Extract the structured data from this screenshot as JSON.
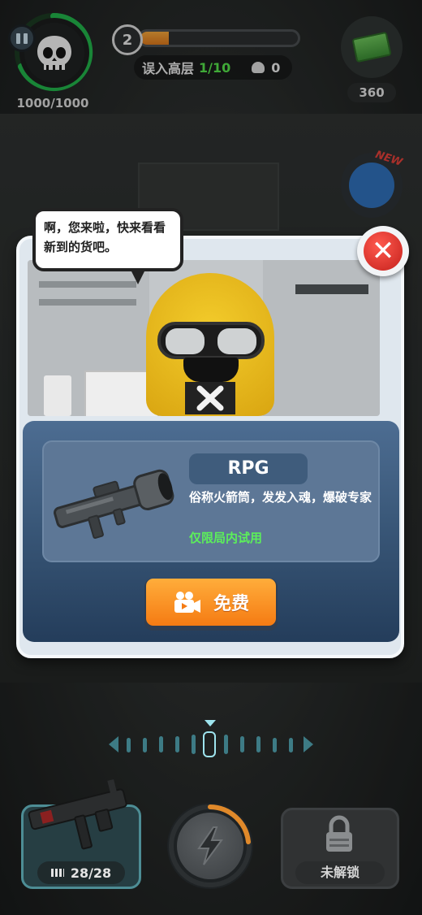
{
  "hud": {
    "hp_text": "1000/1000",
    "level": "2",
    "level_progress": 0.18,
    "floor_label": "误入高层",
    "floor_count": "1/10",
    "kill_count": "0",
    "cash": "360",
    "new_tag": "NEW"
  },
  "shop": {
    "speech": "啊，您来啦，快来看看新到的货吧。",
    "item_name": "RPG",
    "item_desc": "俗称火箭筒，发发入魂，爆破专家",
    "item_trial": "仅限局内试用",
    "free_button": "免费",
    "close_icon": "close-x-icon"
  },
  "bottom": {
    "ammo": "28/28",
    "locked_label": "未解锁"
  },
  "colors": {
    "accent_orange": "#f57b13",
    "trial_green": "#5cef5a",
    "floor_green": "#55e04a",
    "close_red": "#c4201c"
  }
}
